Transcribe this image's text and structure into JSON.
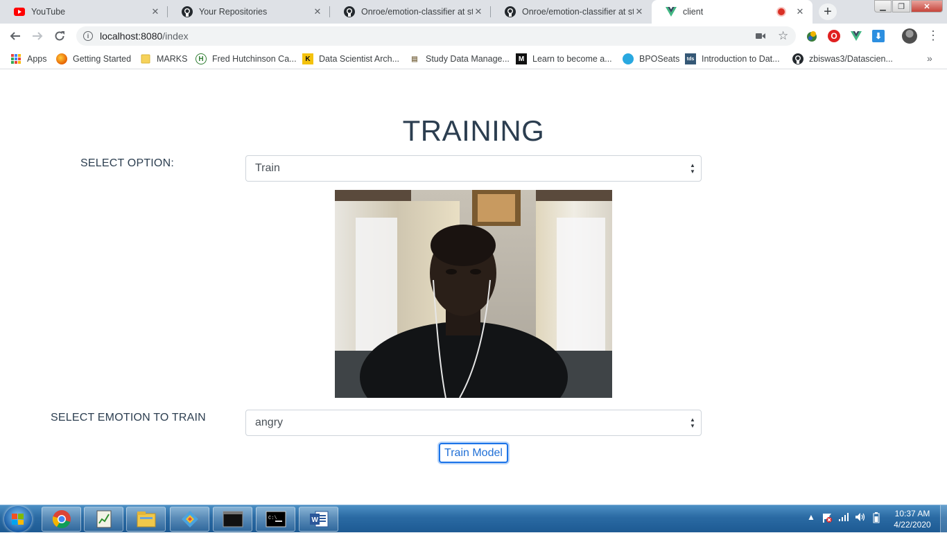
{
  "browser": {
    "tabs": [
      {
        "title": "YouTube",
        "icon": "youtube-icon"
      },
      {
        "title": "Your Repositories",
        "icon": "github-icon"
      },
      {
        "title": "Onroe/emotion-classifier at step",
        "icon": "github-icon"
      },
      {
        "title": "Onroe/emotion-classifier at step",
        "icon": "github-icon"
      },
      {
        "title": "client",
        "icon": "vue-icon",
        "active": true,
        "recording": true
      }
    ],
    "address": {
      "host": "localhost:8080",
      "path": "/index"
    },
    "bookmarks": [
      {
        "label": "Apps",
        "icon": "apps-grid-icon"
      },
      {
        "label": "Getting Started",
        "icon": "firefox-icon"
      },
      {
        "label": "MARKS",
        "icon": "folder-icon"
      },
      {
        "label": "Fred Hutchinson Ca...",
        "icon": "fred-hutch-icon"
      },
      {
        "label": "Data Scientist Arch...",
        "icon": "k-logo-icon"
      },
      {
        "label": "Study Data Manage...",
        "icon": "study-icon"
      },
      {
        "label": "Learn to become a...",
        "icon": "medium-icon"
      },
      {
        "label": "BPOSeats",
        "icon": "bposeats-icon"
      },
      {
        "label": "Introduction to Dat...",
        "icon": "tds-icon"
      },
      {
        "label": "zbiswas3/Datascien...",
        "icon": "github-icon"
      }
    ],
    "bookmarks_overflow": "»"
  },
  "page": {
    "title": "TRAINING",
    "option_label": "SELECT OPTION:",
    "option_value": "Train",
    "emotion_label": "SELECT EMOTION TO TRAIN",
    "emotion_value": "angry",
    "train_button": "Train Model"
  },
  "taskbar": {
    "apps": [
      "chrome-icon",
      "notepad-chart-icon",
      "file-explorer-icon",
      "git-icon",
      "command-prompt-icon",
      "command-prompt-icon",
      "word-icon"
    ],
    "clock": {
      "time": "10:37 AM",
      "date": "4/22/2020"
    }
  },
  "colors": {
    "heading": "#2c3e50",
    "accent": "#1a73e8",
    "tabstrip": "#dee1e6",
    "taskbar": "#2a6aa3"
  }
}
